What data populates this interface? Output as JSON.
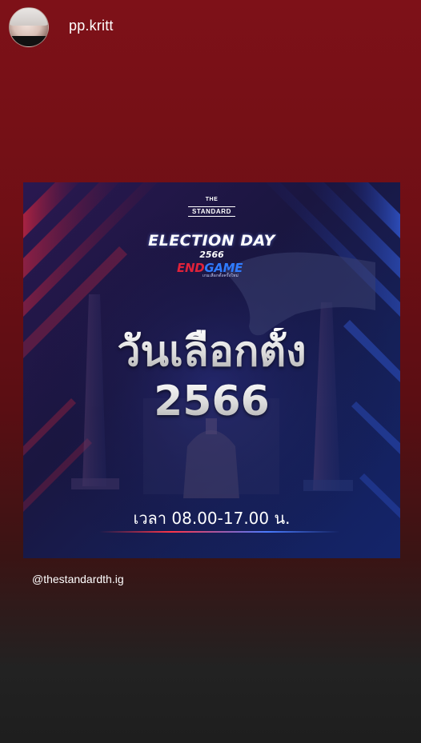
{
  "story": {
    "username": "pp.kritt",
    "credit": "@thestandardth.ig"
  },
  "post": {
    "brand_the": "THE",
    "brand_standard": "STANDARD",
    "event_title": "ELECTION DAY",
    "event_year": "2566",
    "endgame_end": "END",
    "endgame_game": "GAME",
    "endgame_sub": "เกมเลือกตั้งครั้งใหม่",
    "headline": "วันเลือกตั้ง",
    "headline_year": "2566",
    "time_text": "เวลา 08.00-17.00 น."
  },
  "colors": {
    "background_top": "#7e1118",
    "background_bottom": "#1e1e1e",
    "accent_red": "#e0223a",
    "accent_blue": "#2f7bff"
  }
}
